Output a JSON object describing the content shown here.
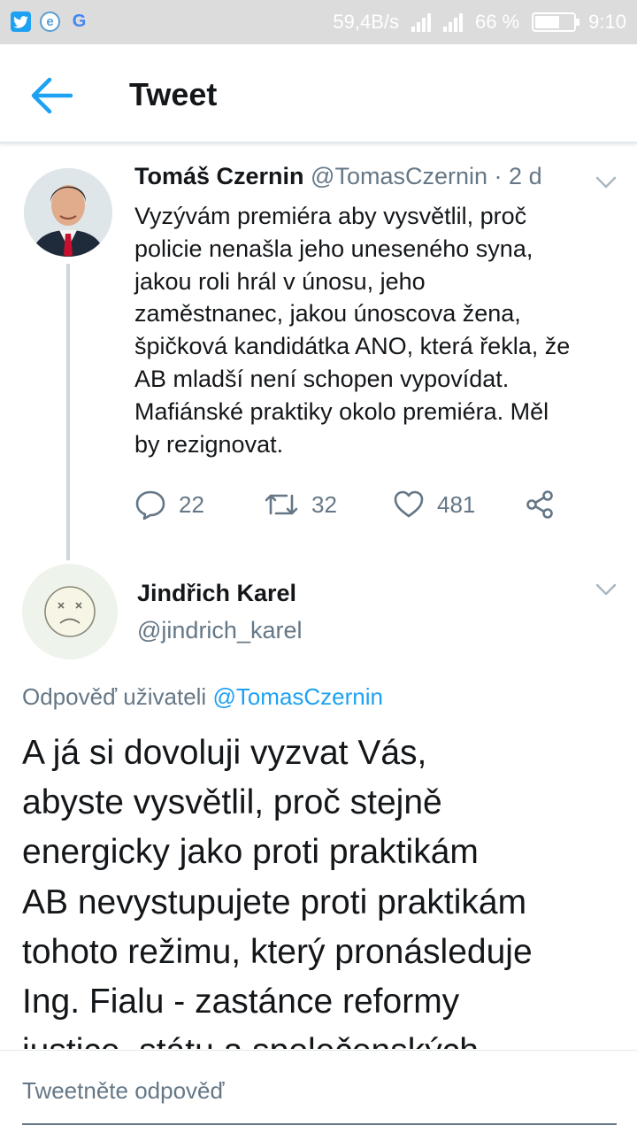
{
  "status_bar": {
    "app_icons": [
      "twitter-icon",
      "e-icon",
      "google-icon"
    ],
    "net_speed": "59,4B/s",
    "battery": "66 %",
    "battery_level": 0.66,
    "time": "9:10"
  },
  "header": {
    "title": "Tweet"
  },
  "tweet": {
    "name": "Tomáš Czernin",
    "handle": "@TomasCzernin",
    "separator": "·",
    "time": "2 d",
    "lines": [
      "Vyzývám premiéra aby vysvětlil, proč",
      "policie nenašla jeho uneseného syna,",
      "jakou roli hrál v únosu, jeho",
      "zaměstnanec, jakou únoscova žena,",
      "špičková kandidátka ANO, která řekla, že",
      "AB mladší není schopen vypovídat.",
      "Mafiánské praktiky okolo premiéra. Měl",
      "by rezignovat."
    ],
    "replies": "22",
    "retweets": "32",
    "likes": "481"
  },
  "reply": {
    "name": "Jindřich Karel",
    "handle": "@jindrich_karel",
    "replying_prefix": "Odpověď uživateli",
    "replying_mention": "@TomasCzernin",
    "lines": [
      "A já si dovoluji vyzvat Vás,",
      "abyste vysvětlil, proč stejně",
      "energicky jako proti praktikám",
      "AB nevystupujete proti praktikám",
      "tohoto režimu, který pronásleduje",
      "Ing. Fialu - zastánce reformy",
      "justice, státu a společenských"
    ]
  },
  "compose": {
    "placeholder": "Tweetněte odpověď"
  },
  "colors": {
    "accent": "#1da1f2",
    "secondary_text": "#657786",
    "divider": "#e1e8ed"
  }
}
